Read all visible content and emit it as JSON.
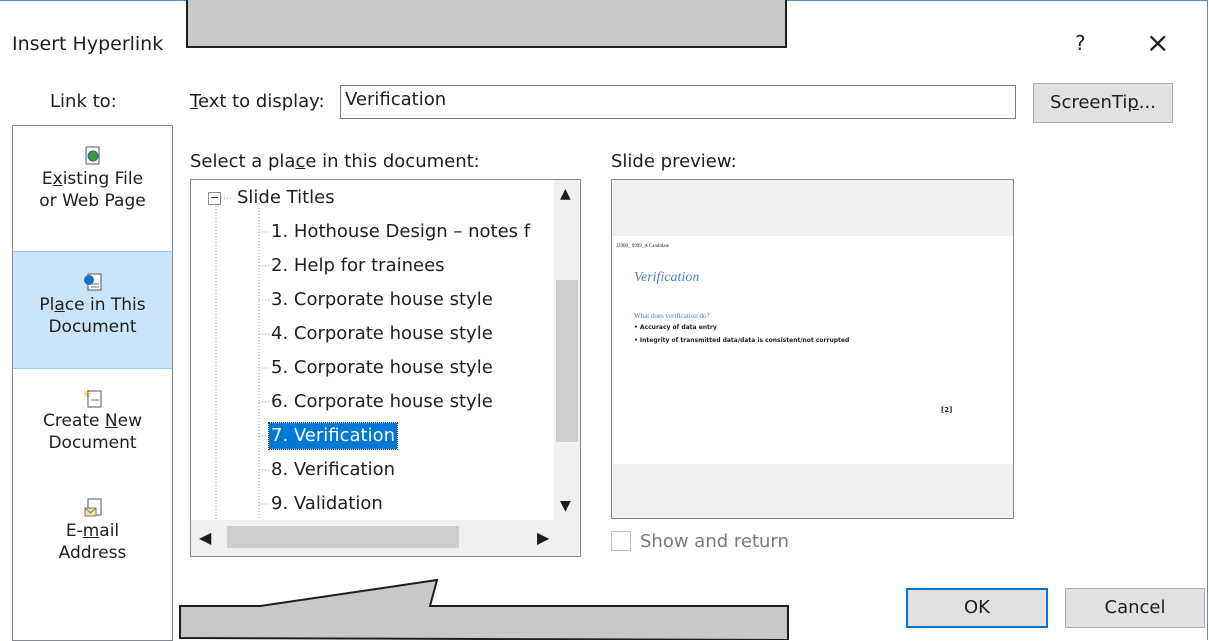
{
  "dialog": {
    "title": "Insert Hyperlink",
    "help_label": "?",
    "close_label": "×"
  },
  "link_to": {
    "label": "Link to:",
    "items": [
      {
        "line1_pre": "E",
        "line1_u": "x",
        "line1_post": "isting File",
        "line2": "or Web Page"
      },
      {
        "line1_pre": "Pl",
        "line1_u": "a",
        "line1_post": "ce in This",
        "line2": "Document"
      },
      {
        "line1_pre": "Create ",
        "line1_u": "N",
        "line1_post": "ew",
        "line2": "Document"
      },
      {
        "line1_pre": "E-",
        "line1_u": "m",
        "line1_post": "ail",
        "line2": "Address"
      }
    ]
  },
  "text_to_display": {
    "label_u": "T",
    "label_rest": "ext to display:",
    "value": "Verification"
  },
  "screentip": {
    "pre": "ScreenTi",
    "u": "p",
    "post": "..."
  },
  "place": {
    "label_pre": "Select a pla",
    "label_u": "c",
    "label_post": "e in this document:",
    "root": "Slide Titles",
    "items": [
      "1. Hothouse Design – notes f",
      "2. Help for trainees",
      "3. Corporate house style",
      "4. Corporate house style",
      "5. Corporate house style",
      "6. Corporate house style",
      "7. Verification",
      "8. Verification",
      "9. Validation"
    ]
  },
  "preview": {
    "label": "Slide preview:",
    "header": "J2900_ 9999_A Candidate",
    "slide_title": "Verification",
    "question": "What does verification do?",
    "bullets": [
      "• Accuracy of data entry",
      "• Integrity of transmitted data/data is consistent/not corrupted"
    ],
    "marks": "[2]"
  },
  "show_and_return": "Show and return",
  "buttons": {
    "ok": "OK",
    "cancel": "Cancel"
  },
  "colors": {
    "accent": "#0078d7",
    "selected_bg": "#cce4f7",
    "callout": "#c8c8c8"
  }
}
